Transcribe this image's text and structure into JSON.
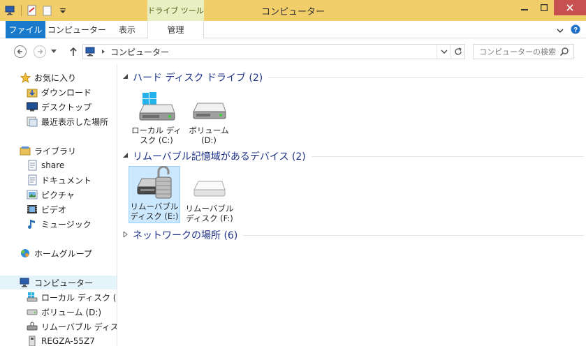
{
  "window": {
    "title": "コンピューター",
    "context_tab_group": "ドライブ ツール"
  },
  "ribbon": {
    "tabs": [
      {
        "label": "ファイル"
      },
      {
        "label": "コンピューター"
      },
      {
        "label": "表示"
      },
      {
        "label": "管理"
      }
    ]
  },
  "address": {
    "path": "コンピューター",
    "search_placeholder": "コンピューターの検索"
  },
  "nav": {
    "favorites": {
      "label": "お気に入り",
      "items": [
        "ダウンロード",
        "デスクトップ",
        "最近表示した場所"
      ]
    },
    "libraries": {
      "label": "ライブラリ",
      "items": [
        "share",
        "ドキュメント",
        "ピクチャ",
        "ビデオ",
        "ミュージック"
      ]
    },
    "homegroup": {
      "label": "ホームグループ"
    },
    "computer": {
      "label": "コンピューター",
      "items": [
        "ローカル ディスク (C:)",
        "ボリューム (D:)",
        "リムーバブル ディスク (E:)",
        "REGZA-55Z7"
      ]
    }
  },
  "content": {
    "groups": [
      {
        "header": "ハード ディスク ドライブ (2)",
        "items": [
          {
            "label": "ローカル ディスク (C:)",
            "line1": "ローカル ディ",
            "line2": "スク (C:)"
          },
          {
            "label": "ボリューム (D:)",
            "line1": "ボリューム",
            "line2": "(D:)"
          }
        ]
      },
      {
        "header": "リムーバブル記憶域があるデバイス (2)",
        "items": [
          {
            "label": "リムーバブル ディスク (E:)",
            "line1": "リムーバブル",
            "line2": "ディスク (E:)"
          },
          {
            "label": "リムーバブル ディスク (F:)",
            "line1": "リムーバブル",
            "line2": "ディスク (F:)"
          }
        ]
      },
      {
        "header": "ネットワークの場所 (6)"
      }
    ]
  },
  "colors": {
    "titlebar": "#f1ce6a",
    "file_tab": "#1979ca",
    "close_button": "#c75050",
    "group_header_text": "#1e3287",
    "selection": "#cce8ff"
  }
}
